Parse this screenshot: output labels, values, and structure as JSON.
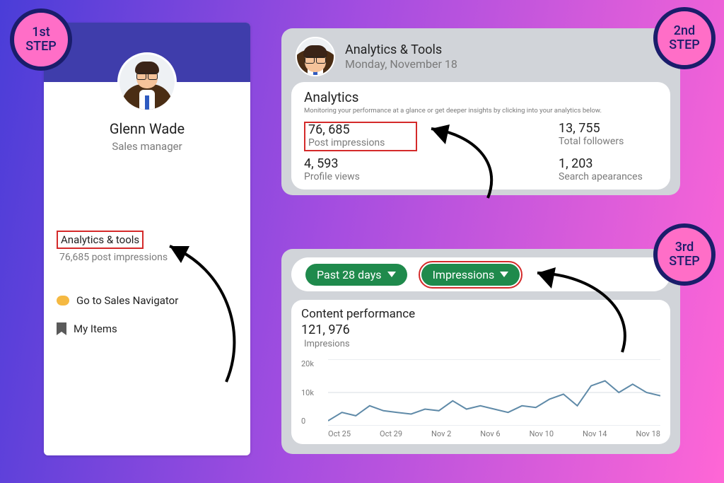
{
  "steps": {
    "first_a": "1st",
    "first_b": "STEP",
    "second_a": "2nd",
    "second_b": "STEP",
    "third_a": "3rd",
    "third_b": "STEP"
  },
  "sidebar": {
    "name": "Glenn Wade",
    "title": "Sales manager",
    "analytics_link": "Analytics & tools",
    "analytics_sub": "76,685 post impressions",
    "sales_nav": "Go to Sales Navigator",
    "my_items": "My Items"
  },
  "analytics_header": {
    "title": "Analytics & Tools",
    "date": "Monday, November 18"
  },
  "analytics_body": {
    "heading": "Analytics",
    "sub": "Monitoring your performance at a glance or get deeper insights by clicking into your analytics below.",
    "metrics": {
      "post_impressions_num": "76, 685",
      "post_impressions_lbl": "Post impressions",
      "total_followers_num": "13, 755",
      "total_followers_lbl": "Total followers",
      "profile_views_num": "4, 593",
      "profile_views_lbl": "Profile views",
      "search_appearances_num": "1, 203",
      "search_appearances_lbl": "Search apearances"
    }
  },
  "filters": {
    "range": "Past 28 days",
    "metric": "Impressions"
  },
  "content_perf": {
    "title": "Content performance",
    "total_num": "121, 976",
    "total_lbl": "Impresions"
  },
  "chart_data": {
    "type": "line",
    "title": "Content performance",
    "ylabel": "Impressions",
    "xlabel": "",
    "ylim": [
      0,
      20000
    ],
    "y_ticks": [
      "20k",
      "10k",
      "0"
    ],
    "categories": [
      "Oct 25",
      "Oct 29",
      "Nov 2",
      "Nov 6",
      "Nov 10",
      "Nov 14",
      "Nov 18"
    ],
    "x": [
      0,
      1,
      2,
      3,
      4,
      5,
      6,
      7,
      8,
      9,
      10,
      11,
      12,
      13,
      14,
      15,
      16,
      17,
      18,
      19,
      20,
      21,
      22,
      23,
      24
    ],
    "series": [
      {
        "name": "Impressions",
        "values": [
          1500,
          4000,
          3000,
          6000,
          4500,
          4000,
          3500,
          5000,
          4500,
          7500,
          5000,
          6000,
          5000,
          4000,
          6000,
          5500,
          8000,
          9500,
          6000,
          12000,
          13500,
          10000,
          12500,
          10000,
          9000
        ]
      }
    ]
  }
}
